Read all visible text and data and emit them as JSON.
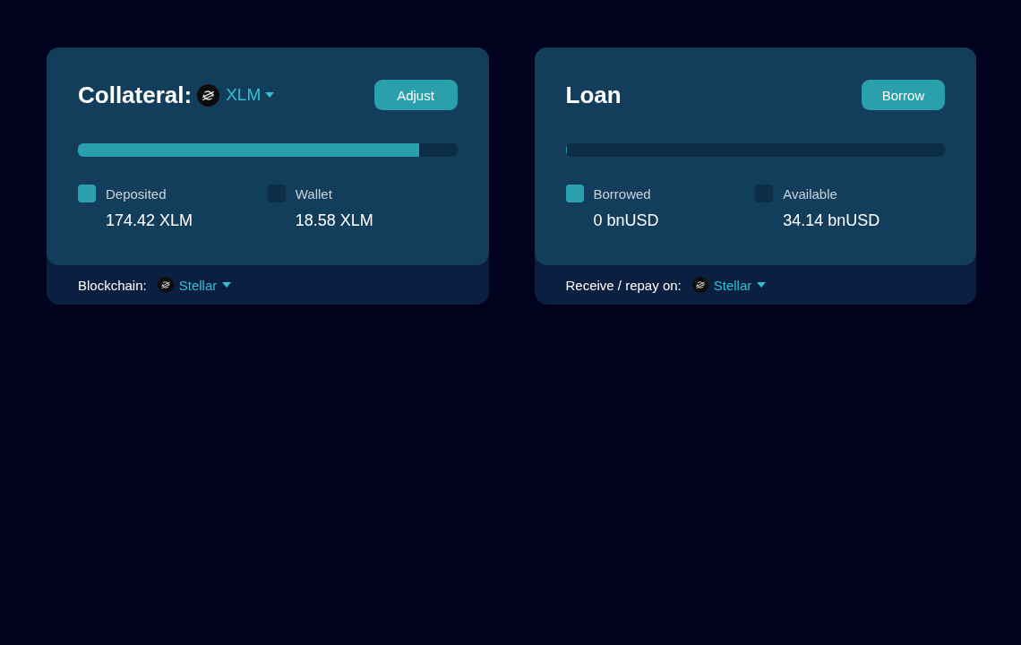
{
  "cards": [
    {
      "title": "Collateral:",
      "asset": "XLM",
      "button": "Adjust",
      "level": 0.9,
      "legend": [
        {
          "label": "Deposited",
          "value": "174.42 XLM",
          "color": "#2aa0ad"
        },
        {
          "label": "Wallet",
          "value": "18.58 XLM",
          "color": "#0b2e46"
        }
      ],
      "footer_label": "Blockchain:",
      "network": "Stellar"
    },
    {
      "title": "Loan",
      "button": "Borrow",
      "level": 0,
      "legend": [
        {
          "label": "Borrowed",
          "value": "0 bnUSD",
          "color": "#2aa0ad"
        },
        {
          "label": "Available",
          "value": "34.14 bnUSD",
          "color": "#0b2e46"
        }
      ],
      "footer_label": "Receive / repay on:",
      "network": "Stellar"
    }
  ]
}
